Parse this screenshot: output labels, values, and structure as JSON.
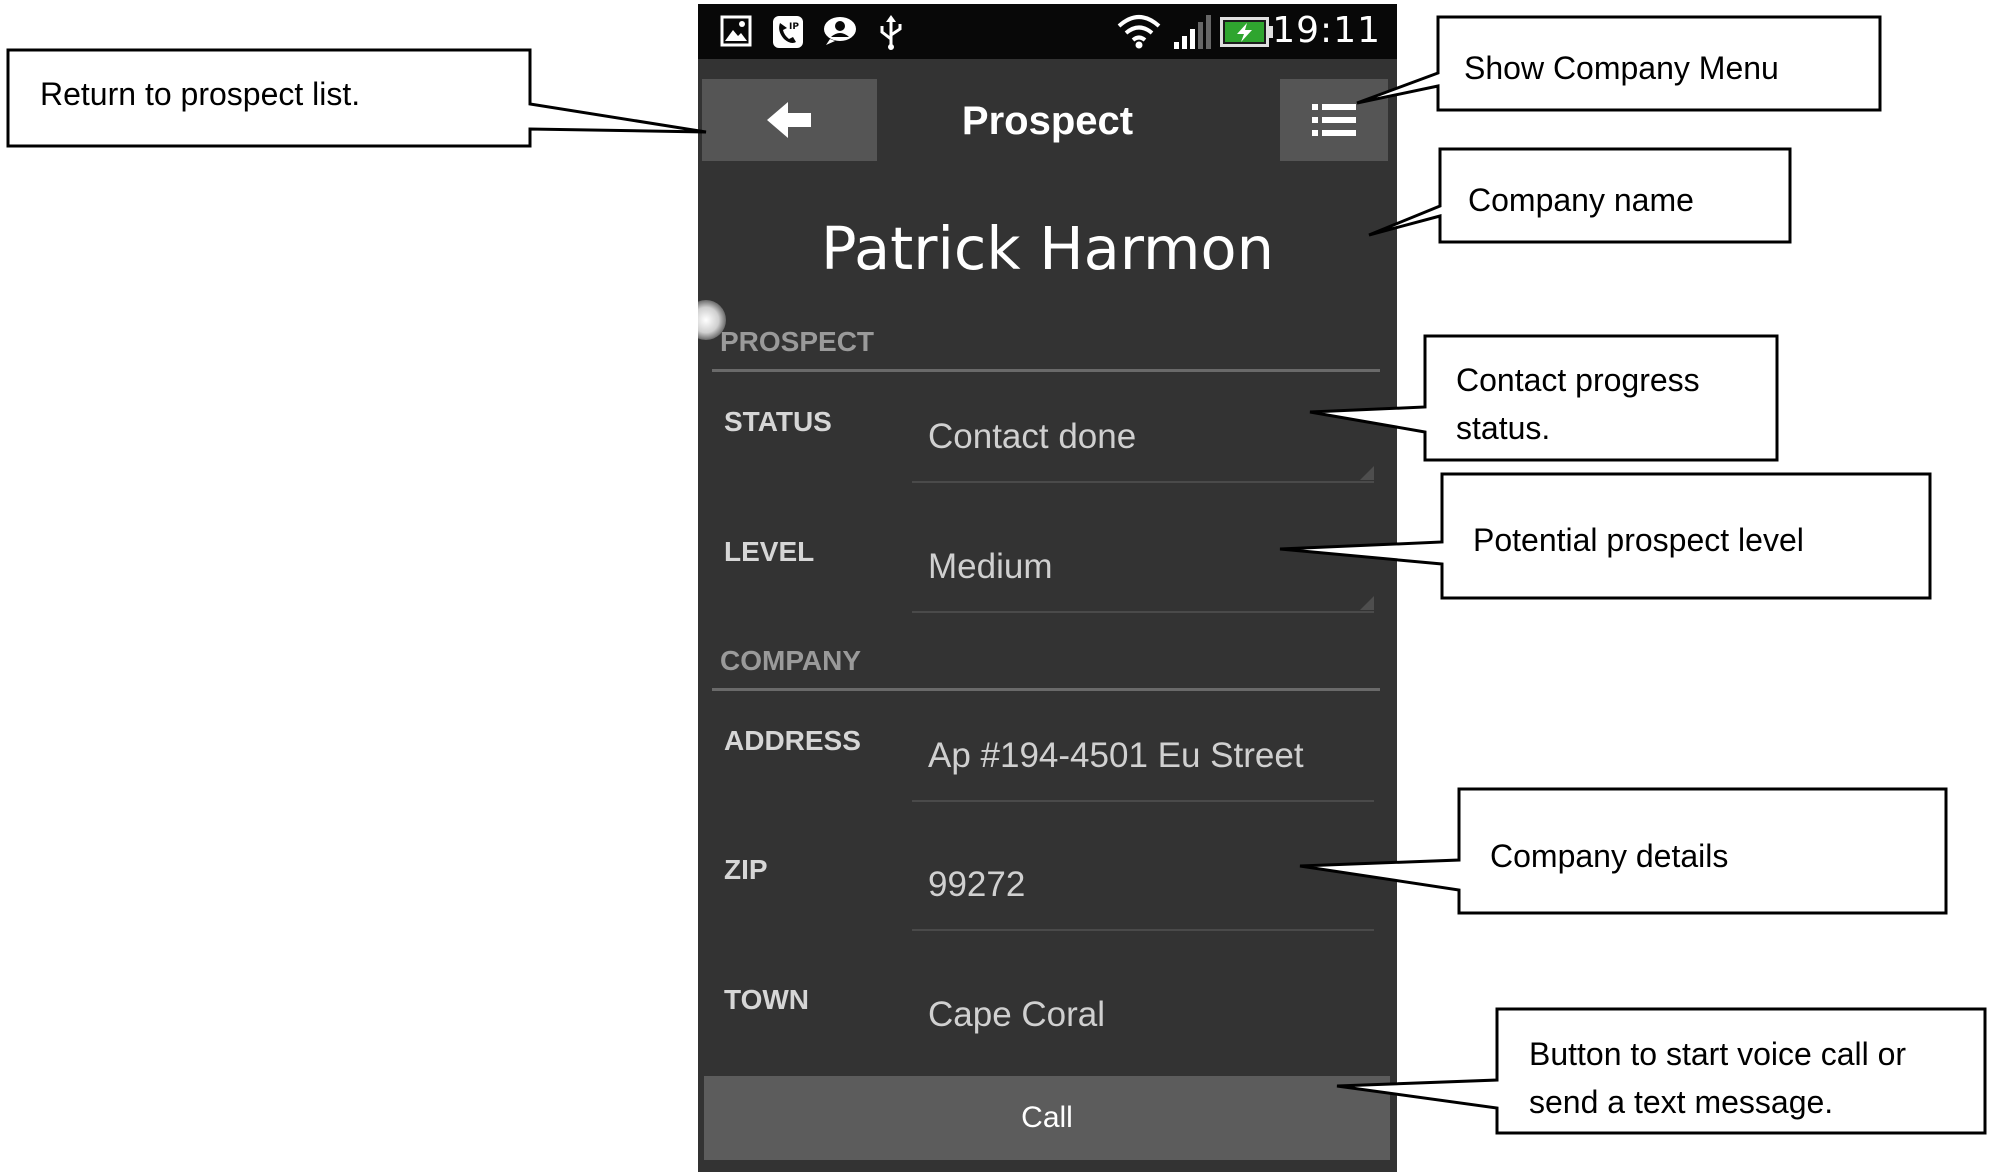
{
  "status_bar": {
    "time": "19:11",
    "left_icons": [
      "gallery-icon",
      "voip-phone-icon",
      "chat-bubble-icon",
      "usb-icon"
    ],
    "right_icons": [
      "wifi-icon",
      "signal-icon",
      "battery-charging-icon"
    ]
  },
  "action_bar": {
    "title": "Prospect",
    "back_icon": "arrow-left-icon",
    "menu_icon": "list-menu-icon"
  },
  "company_name": "Patrick Harmon",
  "prospect_section": {
    "title": "PROSPECT",
    "fields": [
      {
        "label": "STATUS",
        "value": "Contact done"
      },
      {
        "label": "LEVEL",
        "value": "Medium"
      }
    ]
  },
  "company_section": {
    "title": "COMPANY",
    "fields": [
      {
        "label": "ADDRESS",
        "value": "Ap #194-4501 Eu Street"
      },
      {
        "label": "ZIP",
        "value": "99272"
      },
      {
        "label": "TOWN",
        "value": "Cape Coral"
      }
    ]
  },
  "call_button": "Call",
  "callouts": {
    "back": "Return to prospect list.",
    "menu": "Show Company Menu",
    "company_name": "Company name",
    "status": [
      "Contact progress",
      "status."
    ],
    "level": "Potential prospect level",
    "details": "Company details",
    "call": [
      "Button to start voice call or",
      "send a text message."
    ]
  }
}
